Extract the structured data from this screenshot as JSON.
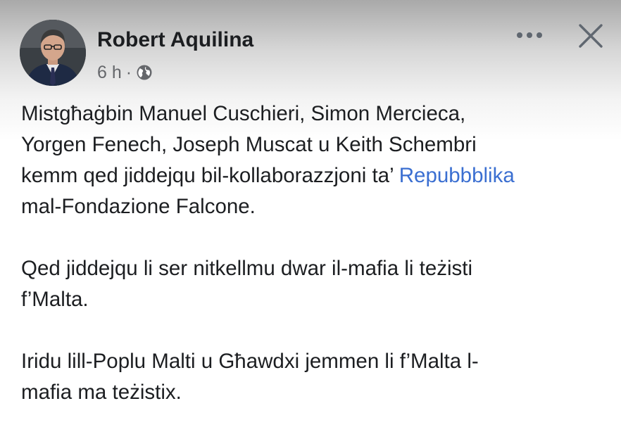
{
  "post": {
    "author": "Robert Aquilina",
    "timestamp": "6 h",
    "separator": "·",
    "audience_icon": "globe-icon",
    "more_icon": "more-options-icon",
    "close_icon": "close-icon",
    "paragraphs": [
      {
        "lines": [
          {
            "text": "Mistgħaġbin Manuel Cuschieri, Simon Mercieca,"
          },
          {
            "text": "Yorgen Fenech, Joseph Muscat u Keith Schembri"
          },
          {
            "text": "kemm qed jiddejqu bil-kollaborazzjoni ta’ ",
            "link": "Repubbblika"
          },
          {
            "text": "mal-Fondazione Falcone."
          }
        ]
      },
      {
        "lines": [
          {
            "text": "Qed jiddejqu li ser nitkellmu dwar il-mafia li teżisti"
          },
          {
            "text": "f’Malta."
          }
        ]
      },
      {
        "lines": [
          {
            "text": "Iridu lill-Poplu Malti u Għawdxi jemmen li f’Malta l-"
          },
          {
            "text": "mafia ma teżistix."
          }
        ]
      }
    ]
  },
  "colors": {
    "text": "#1c1e21",
    "secondary": "#65676b",
    "link": "#3b6fd1"
  }
}
